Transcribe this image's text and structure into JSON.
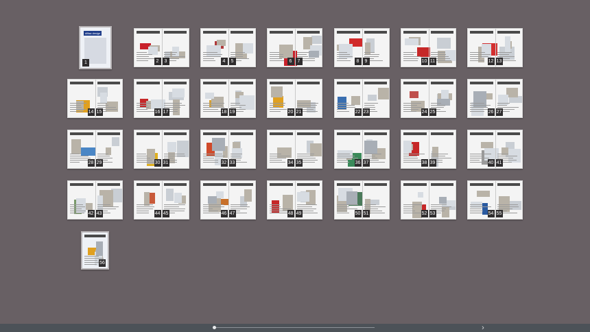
{
  "viewer": {
    "background": "#686064",
    "footer_color": "#4c5258"
  },
  "cover": {
    "logo_text": "dilfaa design"
  },
  "thumbnails": [
    {
      "pages": [
        "1"
      ]
    },
    {
      "pages": [
        "2",
        "3"
      ],
      "accent": "#c8202a"
    },
    {
      "pages": [
        "4",
        "5"
      ],
      "accent": "#b03a3a"
    },
    {
      "pages": [
        "6",
        "7"
      ],
      "accent": "#c8202a"
    },
    {
      "pages": [
        "8",
        "9"
      ],
      "accent": "#d12a2a"
    },
    {
      "pages": [
        "10",
        "11"
      ],
      "accent": "#c62828"
    },
    {
      "pages": [
        "12",
        "13"
      ],
      "accent": "#d32f2f"
    },
    {
      "pages": [
        "14",
        "15"
      ],
      "accent": "#e0a020"
    },
    {
      "pages": [
        "16",
        "17"
      ],
      "accent": "#c62828"
    },
    {
      "pages": [
        "18",
        "19"
      ],
      "accent": "#d8a030"
    },
    {
      "pages": [
        "20",
        "21"
      ],
      "accent": "#e0a020"
    },
    {
      "pages": [
        "22",
        "23"
      ],
      "accent": "#3a6fb0"
    },
    {
      "pages": [
        "24",
        "25"
      ],
      "accent": "#c0504d"
    },
    {
      "pages": [
        "26",
        "27"
      ],
      "accent": "#d05050"
    },
    {
      "pages": [
        "28",
        "29"
      ],
      "accent": "#4a86c5"
    },
    {
      "pages": [
        "30",
        "31"
      ],
      "accent": "#e0b020"
    },
    {
      "pages": [
        "32",
        "33"
      ],
      "accent": "#d04a2a"
    },
    {
      "pages": [
        "34",
        "35"
      ],
      "accent": "#c62828"
    },
    {
      "pages": [
        "36",
        "37"
      ],
      "accent": "#3a8a5a"
    },
    {
      "pages": [
        "38",
        "39"
      ],
      "accent": "#c62828"
    },
    {
      "pages": [
        "40",
        "41"
      ],
      "accent": "#9a9a9a"
    },
    {
      "pages": [
        "42",
        "43"
      ],
      "accent": "#7a9a6a"
    },
    {
      "pages": [
        "44",
        "45"
      ],
      "accent": "#c85a3a"
    },
    {
      "pages": [
        "46",
        "47"
      ],
      "accent": "#c8702a"
    },
    {
      "pages": [
        "48",
        "49"
      ],
      "accent": "#c62828"
    },
    {
      "pages": [
        "50",
        "51"
      ],
      "accent": "#4a7a5a"
    },
    {
      "pages": [
        "52",
        "53"
      ],
      "accent": "#c62828"
    },
    {
      "pages": [
        "54",
        "55"
      ],
      "accent": "#2a5aa0"
    },
    {
      "pages": [
        "56"
      ],
      "accent": "#e0a020"
    }
  ],
  "footer": {
    "scrubber_position": 0,
    "next_icon": "chevron-right-icon",
    "next_glyph": "›"
  }
}
